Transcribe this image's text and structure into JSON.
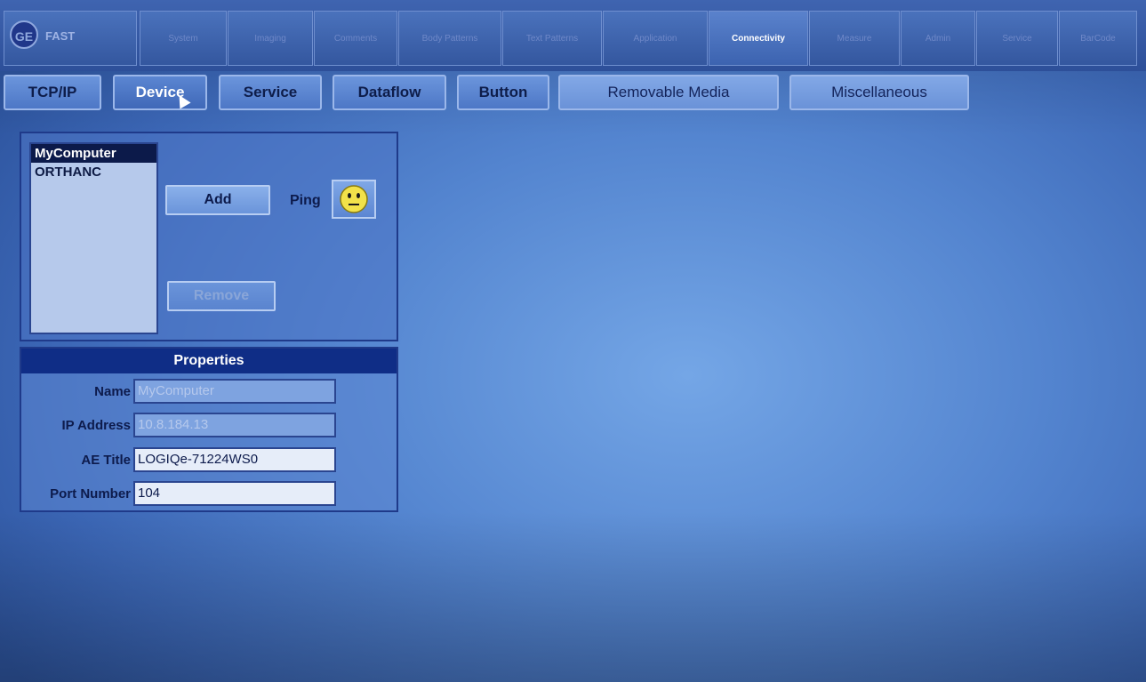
{
  "logo": {
    "text": "FAST",
    "emblem": "GE"
  },
  "top_tabs": [
    {
      "label": "System"
    },
    {
      "label": "Imaging"
    },
    {
      "label": "Comments"
    },
    {
      "label": "Body Patterns"
    },
    {
      "label": "Text Patterns"
    },
    {
      "label": "Application"
    },
    {
      "label": "Connectivity"
    },
    {
      "label": "Measure"
    },
    {
      "label": "Admin"
    },
    {
      "label": "Service"
    },
    {
      "label": "BarCode"
    }
  ],
  "sub_tabs": [
    {
      "label": "TCP/IP"
    },
    {
      "label": "Device"
    },
    {
      "label": "Service"
    },
    {
      "label": "Dataflow"
    },
    {
      "label": "Button"
    },
    {
      "label": "Removable Media"
    },
    {
      "label": "Miscellaneous"
    }
  ],
  "devices": {
    "items": [
      "MyComputer",
      "ORTHANC"
    ],
    "selected": "MyComputer",
    "add_label": "Add",
    "remove_label": "Remove",
    "ping_label": "Ping",
    "ping_icon": "neutral-face-icon"
  },
  "properties": {
    "title": "Properties",
    "name_label": "Name",
    "name_value": "MyComputer",
    "ip_label": "IP Address",
    "ip_value": "10.8.184.13",
    "ae_label": "AE Title",
    "ae_value": "LOGIQe-71224WS0",
    "port_label": "Port Number",
    "port_value": "104"
  },
  "colors": {
    "background": "#5384cf",
    "selected_item": "#0c1a4a",
    "properties_header": "#0f2d86",
    "ping_face": "#f2e24a"
  }
}
